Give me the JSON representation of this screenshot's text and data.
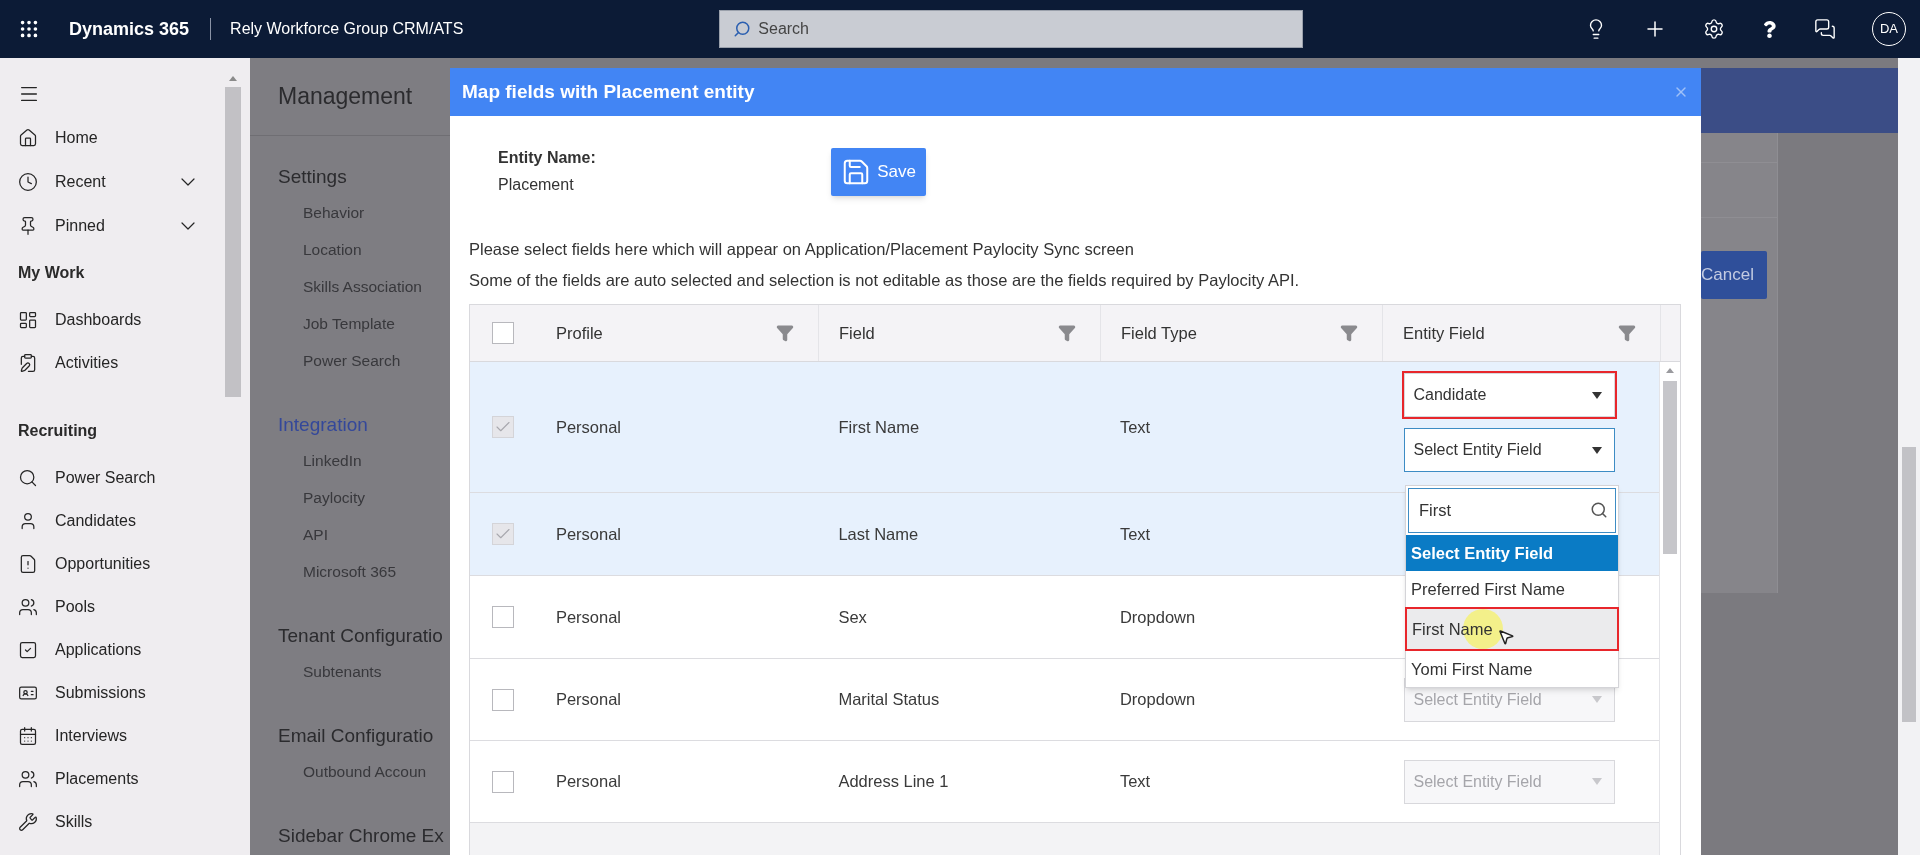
{
  "top_bar": {
    "app_name": "Dynamics 365",
    "org_name": "Rely Workforce Group CRM/ATS",
    "search": {
      "placeholder": "Search"
    },
    "avatar": "DA"
  },
  "nav": {
    "top_items": [
      {
        "label": "Home",
        "kind": "link"
      },
      {
        "label": "Recent",
        "kind": "group",
        "expanded": false
      },
      {
        "label": "Pinned",
        "kind": "group",
        "expanded": false
      }
    ],
    "sections": [
      {
        "heading": "My Work",
        "items": [
          "Dashboards",
          "Activities"
        ]
      },
      {
        "heading": "Recruiting",
        "items": [
          "Power Search",
          "Candidates",
          "Opportunities",
          "Pools",
          "Applications",
          "Submissions",
          "Interviews",
          "Placements",
          "Skills"
        ]
      }
    ]
  },
  "management": {
    "title": "Management",
    "sections": [
      {
        "heading": "Settings",
        "selected": false,
        "items": [
          "Behavior",
          "Location",
          "Skills Association",
          "Job Template",
          "Power Search"
        ]
      },
      {
        "heading": "Integration",
        "selected": true,
        "items": [
          "LinkedIn",
          "Paylocity",
          "API",
          "Microsoft 365"
        ]
      },
      {
        "heading": "Tenant Configuratio",
        "selected": false,
        "items": [
          "Subtenants"
        ]
      },
      {
        "heading": "Email Configuratio",
        "selected": false,
        "items": [
          "Outbound Accoun"
        ]
      },
      {
        "heading": "Sidebar Chrome Ex",
        "selected": false
      }
    ]
  },
  "dialog": {
    "title": "Map fields with Placement entity",
    "entity_label": "Entity Name:",
    "entity_name": "Placement",
    "save_button": "Save",
    "instructions": [
      "Please select fields here which will appear on Application/Placement Paylocity Sync screen",
      "Some of the fields are auto selected and selection is not editable as those are the fields required by Paylocity API."
    ],
    "table": {
      "select_all_checked": false,
      "columns": [
        "Profile",
        "Field",
        "Field Type",
        "Entity Field"
      ],
      "rows": [
        {
          "checked": true,
          "disabled": true,
          "profile": "Personal",
          "field": "First Name",
          "field_type": "Text",
          "entity_selects": [
            {
              "value": "Candidate",
              "outlined": true,
              "disabled": false,
              "open": false
            },
            {
              "value": "Select Entity Field",
              "outlined": false,
              "disabled": false,
              "open": true
            }
          ]
        },
        {
          "checked": true,
          "disabled": true,
          "profile": "Personal",
          "field": "Last Name",
          "field_type": "Text"
        },
        {
          "checked": false,
          "disabled": false,
          "profile": "Personal",
          "field": "Sex",
          "field_type": "Dropdown"
        },
        {
          "checked": false,
          "disabled": false,
          "profile": "Personal",
          "field": "Marital Status",
          "field_type": "Dropdown",
          "entity_selects": [
            {
              "value": "Select Entity Field",
              "outlined": false,
              "disabled": true,
              "open": false
            }
          ]
        },
        {
          "checked": false,
          "disabled": false,
          "profile": "Personal",
          "field": "Address Line 1",
          "field_type": "Text",
          "entity_selects": [
            {
              "value": "Select Entity Field",
              "outlined": false,
              "disabled": true,
              "open": false
            }
          ]
        }
      ]
    },
    "dropdown": {
      "search_value": "First",
      "options": [
        {
          "label": "Select Entity Field",
          "selected": true,
          "hovered": false,
          "outlined": false
        },
        {
          "label": "Preferred First Name",
          "selected": false,
          "hovered": false,
          "outlined": false
        },
        {
          "label": "First Name",
          "selected": false,
          "hovered": true,
          "outlined": true
        },
        {
          "label": "Yomi First Name",
          "selected": false,
          "hovered": false,
          "outlined": false
        }
      ]
    }
  },
  "background": {
    "cancel_button": "Cancel"
  }
}
